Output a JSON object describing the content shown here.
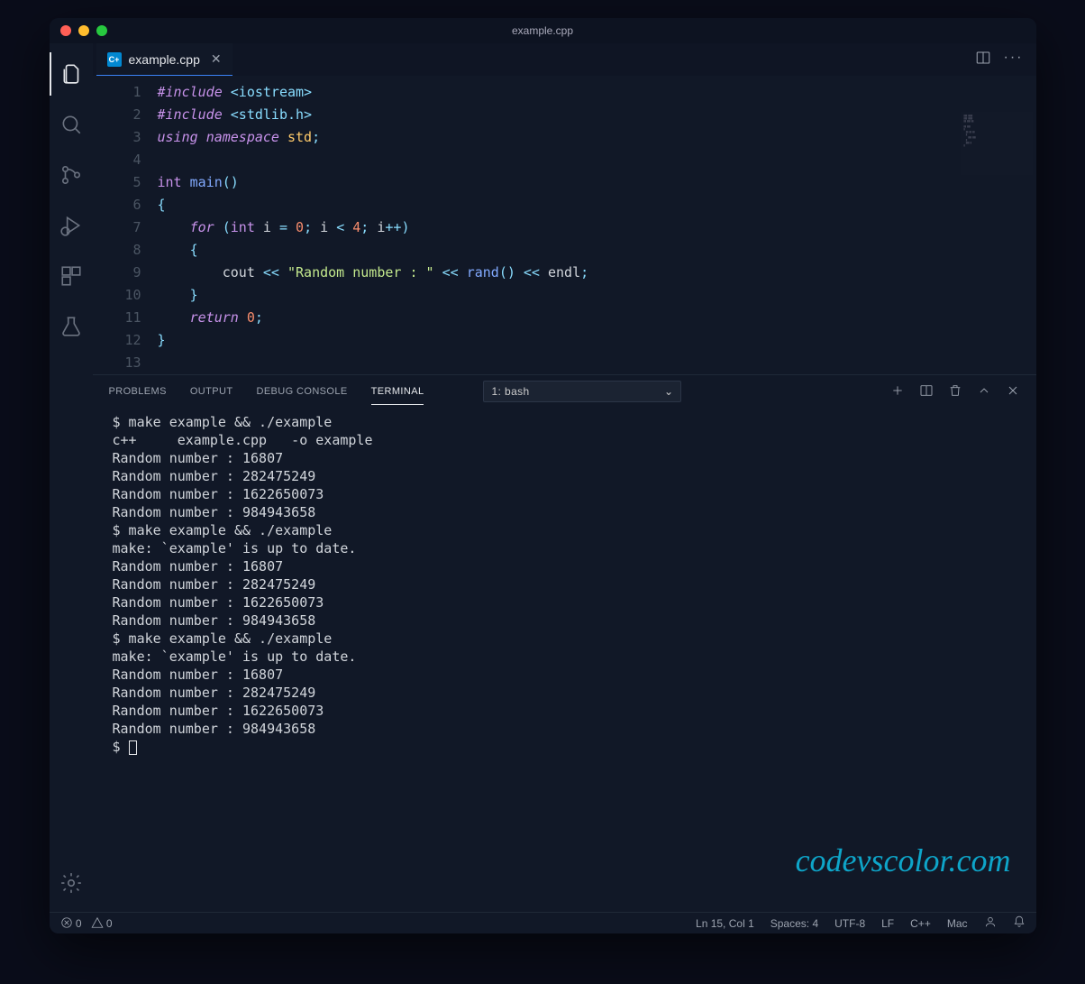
{
  "window": {
    "title": "example.cpp"
  },
  "tab": {
    "filename": "example.cpp",
    "language_badge": "C+"
  },
  "code": {
    "lines": [
      {
        "n": 1,
        "html": "<span class='c-directive'>#include</span> <span class='c-include'>&lt;iostream&gt;</span>"
      },
      {
        "n": 2,
        "html": "<span class='c-directive'>#include</span> <span class='c-include'>&lt;stdlib.h&gt;</span>"
      },
      {
        "n": 3,
        "html": "<span class='c-keyword'>using</span> <span class='c-keyword'>namespace</span> <span class='c-ns'>std</span><span class='c-punct'>;</span>"
      },
      {
        "n": 4,
        "html": ""
      },
      {
        "n": 5,
        "html": "<span class='c-type'>int</span> <span class='c-func'>main</span><span class='c-punct'>()</span>"
      },
      {
        "n": 6,
        "html": "<span class='c-punct'>{</span>"
      },
      {
        "n": 7,
        "html": "    <span class='c-keyword'>for</span> <span class='c-punct'>(</span><span class='c-type'>int</span> i <span class='c-punct'>=</span> <span class='c-num'>0</span><span class='c-punct'>;</span> i <span class='c-punct'>&lt;</span> <span class='c-num'>4</span><span class='c-punct'>;</span> i<span class='c-punct'>++</span><span class='c-punct'>)</span>"
      },
      {
        "n": 8,
        "html": "    <span class='c-punct'>{</span>"
      },
      {
        "n": 9,
        "html": "        cout <span class='c-punct'>&lt;&lt;</span> <span class='c-string'>\"Random number : \"</span> <span class='c-punct'>&lt;&lt;</span> <span class='c-func'>rand</span><span class='c-punct'>()</span> <span class='c-punct'>&lt;&lt;</span> endl<span class='c-punct'>;</span>"
      },
      {
        "n": 10,
        "html": "    <span class='c-punct'>}</span>"
      },
      {
        "n": 11,
        "html": "    <span class='c-return'>return</span> <span class='c-num'>0</span><span class='c-punct'>;</span>"
      },
      {
        "n": 12,
        "html": "<span class='c-punct'>}</span>"
      },
      {
        "n": 13,
        "html": ""
      }
    ]
  },
  "panel": {
    "tabs": [
      "PROBLEMS",
      "OUTPUT",
      "DEBUG CONSOLE",
      "TERMINAL"
    ],
    "active": "TERMINAL",
    "terminal_select": "1: bash"
  },
  "terminal_lines": [
    "$ make example && ./example",
    "c++     example.cpp   -o example",
    "Random number : 16807",
    "Random number : 282475249",
    "Random number : 1622650073",
    "Random number : 984943658",
    "$ make example && ./example",
    "make: `example' is up to date.",
    "Random number : 16807",
    "Random number : 282475249",
    "Random number : 1622650073",
    "Random number : 984943658",
    "$ make example && ./example",
    "make: `example' is up to date.",
    "Random number : 16807",
    "Random number : 282475249",
    "Random number : 1622650073",
    "Random number : 984943658"
  ],
  "terminal_prompt": "$ ",
  "watermark": "codevscolor.com",
  "status": {
    "errors": "0",
    "warnings": "0",
    "cursor": "Ln 15, Col 1",
    "spaces": "Spaces: 4",
    "encoding": "UTF-8",
    "eol": "LF",
    "language": "C++",
    "os": "Mac"
  }
}
